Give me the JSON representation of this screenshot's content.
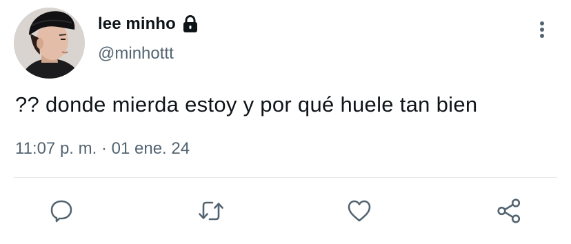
{
  "author": {
    "display_name": "lee minho",
    "handle": "@minhottt",
    "protected": true,
    "avatar_icon": "profile-photo"
  },
  "tweet": {
    "text": "?? donde mierda estoy y por qué huele tan bien",
    "time": "11:07 p. m.",
    "separator": "·",
    "date": "01 ene. 24"
  },
  "actions": [
    {
      "name": "reply",
      "icon": "speech-bubble-icon"
    },
    {
      "name": "retweet",
      "icon": "retweet-arrows-icon"
    },
    {
      "name": "like",
      "icon": "heart-icon"
    },
    {
      "name": "share",
      "icon": "share-nodes-icon"
    }
  ],
  "colors": {
    "text_primary": "#0f1419",
    "text_secondary": "#536471",
    "icon": "#536471",
    "divider": "#e6e9ec",
    "background": "#ffffff"
  }
}
